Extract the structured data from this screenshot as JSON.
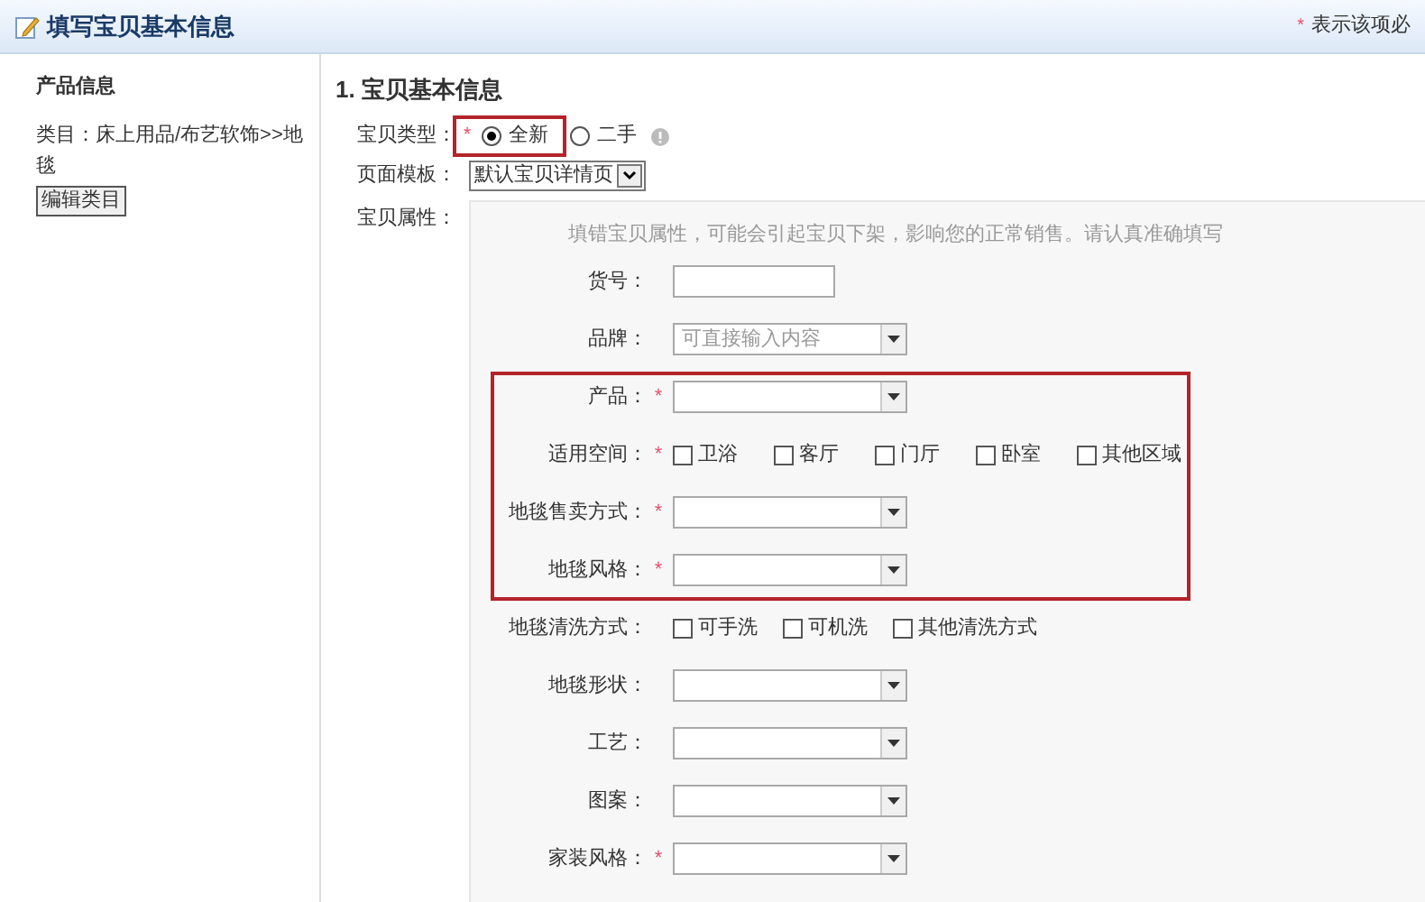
{
  "header": {
    "title": "填写宝贝基本信息",
    "required_note_mark": "*",
    "required_note": "表示该项必"
  },
  "sidebar": {
    "title": "产品信息",
    "category_label": "类目：床上用品/布艺软饰>>地毯",
    "edit_button": "编辑类目"
  },
  "section": {
    "title": "1. 宝贝基本信息"
  },
  "item_type": {
    "label": "宝贝类型：",
    "required": true,
    "options": [
      {
        "label": "全新",
        "selected": true
      },
      {
        "label": "二手",
        "selected": false
      }
    ]
  },
  "template": {
    "label": "页面模板：",
    "value": "默认宝贝详情页"
  },
  "attributes": {
    "label": "宝贝属性：",
    "hint": "填错宝贝属性，可能会引起宝贝下架，影响您的正常销售。请认真准确填写",
    "rows": [
      {
        "kind": "text",
        "label": "货号：",
        "required": false
      },
      {
        "kind": "select",
        "label": "品牌：",
        "required": false,
        "placeholder": "可直接输入内容"
      },
      {
        "kind": "select",
        "label": "产品：",
        "required": true
      },
      {
        "kind": "checkboxes",
        "label": "适用空间：",
        "required": true,
        "options": [
          {
            "label": "卫浴",
            "checked": false
          },
          {
            "label": "客厅",
            "checked": false
          },
          {
            "label": "门厅",
            "checked": false
          },
          {
            "label": "卧室",
            "checked": false
          },
          {
            "label": "其他区域",
            "checked": false
          }
        ]
      },
      {
        "kind": "select",
        "label": "地毯售卖方式：",
        "required": true
      },
      {
        "kind": "select",
        "label": "地毯风格：",
        "required": true
      },
      {
        "kind": "checkboxes",
        "label": "地毯清洗方式：",
        "required": false,
        "options": [
          {
            "label": "可手洗",
            "checked": false
          },
          {
            "label": "可机洗",
            "checked": false
          },
          {
            "label": "其他清洗方式",
            "checked": false
          }
        ]
      },
      {
        "kind": "select",
        "label": "地毯形状：",
        "required": false
      },
      {
        "kind": "select",
        "label": "工艺：",
        "required": false
      },
      {
        "kind": "select",
        "label": "图案：",
        "required": false
      },
      {
        "kind": "select",
        "label": "家装风格：",
        "required": true
      }
    ]
  }
}
